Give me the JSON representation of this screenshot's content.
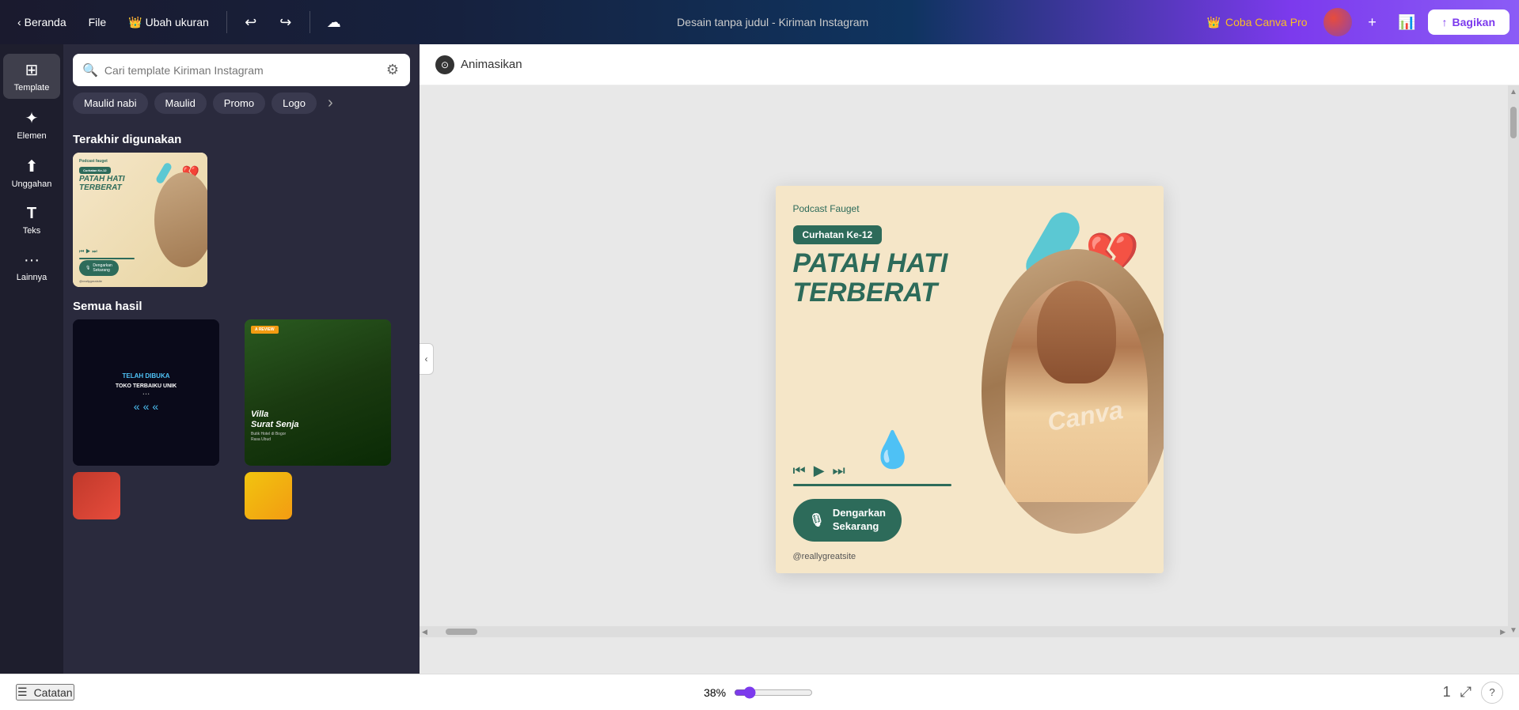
{
  "nav": {
    "beranda": "Beranda",
    "file": "File",
    "ubah_ukuran": "Ubah ukuran",
    "title": "Desain tanpa judul - Kiriman Instagram",
    "coba_pro": "Coba Canva Pro",
    "bagikan": "Bagikan",
    "undo_icon": "↩",
    "redo_icon": "↪"
  },
  "sidebar": {
    "items": [
      {
        "id": "template",
        "label": "Template",
        "icon": "⊞"
      },
      {
        "id": "elemen",
        "label": "Elemen",
        "icon": "✦"
      },
      {
        "id": "unggahan",
        "label": "Unggahan",
        "icon": "⬆"
      },
      {
        "id": "teks",
        "label": "Teks",
        "icon": "T"
      },
      {
        "id": "lainnya",
        "label": "Lainnya",
        "icon": "···"
      }
    ]
  },
  "template_panel": {
    "search_placeholder": "Cari template Kiriman Instagram",
    "filter_icon": "⚙",
    "tags": [
      "Maulid nabi",
      "Maulid",
      "Promo",
      "Logo"
    ],
    "section_recent": "Terakhir digunakan",
    "section_all": "Semua hasil",
    "thumb_podcast_label": "Podcast fauget",
    "thumb_toko_title": "TELAH DIBUKA TOKO TERBAIKU UNIK",
    "thumb_villa_title": "Villa Surat Senja"
  },
  "toolbar": {
    "animate_icon": "⊙",
    "animate_label": "Animasikan"
  },
  "canvas": {
    "podcast_label": "Podcast Fauget",
    "badge_text": "Curhatan Ke-12",
    "main_title_line1": "PATAH HATI",
    "main_title_line2": "TERBERAT",
    "cta_text": "Dengarkan\nSekarang",
    "handle": "@reallygreatsite",
    "watermark": "Canva"
  },
  "bottom": {
    "notes_icon": "☰",
    "notes_label": "Catatan",
    "zoom_value": "38%",
    "page_btn": "1",
    "fullscreen_icon": "⤢",
    "help_icon": "?"
  },
  "colors": {
    "teal_dark": "#2d6b5a",
    "pill_blue": "#5bc8d3",
    "orange": "#d4843a",
    "bg_cream": "#f5e6c8",
    "accent_purple": "#7c3aed"
  }
}
